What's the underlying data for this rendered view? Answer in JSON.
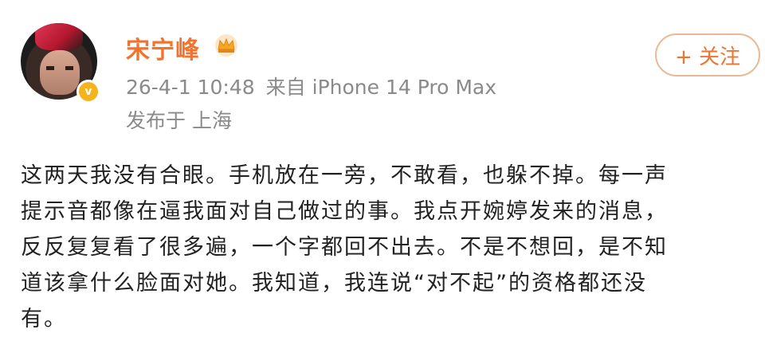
{
  "user": {
    "name": "宋宁峰",
    "crown_icon": "crown-icon",
    "verified_icon": "verified-badge-icon",
    "accent_color": "#f0742d"
  },
  "post": {
    "time": "26-4-1 10:48",
    "source": "来自 iPhone 14 Pro Max",
    "location": "发布于 上海",
    "lines": [
      "这两天我没有合眼。手机放在一旁，不敢看，也躲不掉。每一声",
      "提示音都像在逼我面对自己做过的事。我点开婉婷发来的消息，",
      "反反复复看了很多遍，一个字都回不出去。不是不想回，是不知",
      "道该拿什么脸面对她。我知道，我连说“对不起”的资格都还没",
      "有。"
    ]
  },
  "actions": {
    "follow_label": "+ 关注"
  }
}
